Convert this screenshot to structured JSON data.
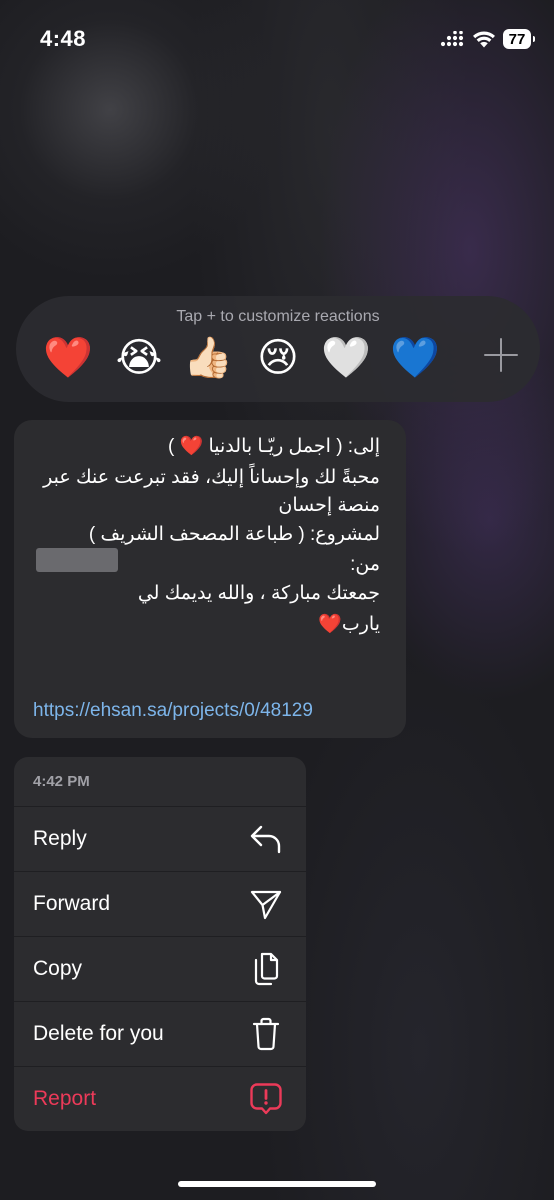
{
  "status_bar": {
    "time": "4:48",
    "battery": "77"
  },
  "reactions": {
    "hint": "Tap + to customize reactions",
    "emojis": [
      {
        "icon": "red-heart-icon",
        "char": "❤️"
      },
      {
        "icon": "loudly-crying-face-icon",
        "char": "😭"
      },
      {
        "icon": "thumbs-up-icon",
        "char": "👍🏻"
      },
      {
        "icon": "crying-face-icon",
        "char": "😢"
      },
      {
        "icon": "white-heart-icon",
        "char": "🤍"
      },
      {
        "icon": "blue-heart-icon",
        "char": "💙"
      }
    ],
    "more_icon": "plus-icon"
  },
  "message": {
    "lines": [
      "إلى: ( اجمل ريّـا بالدنيا ❤️ )",
      "محبةً لك وإحساناً إليك، فقد تبرعت عنك عبر",
      "منصة إحسان",
      "لمشروع: ( طباعة المصحف الشريف )",
      "من:",
      "جمعتك مباركة ، والله يديمك لي",
      "يارب❤️"
    ],
    "link": "https://ehsan.sa/projects/0/48129"
  },
  "context_menu": {
    "timestamp": "4:42 PM",
    "items": [
      {
        "label": "Reply",
        "icon": "reply-arrow-icon"
      },
      {
        "label": "Forward",
        "icon": "paper-plane-icon"
      },
      {
        "label": "Copy",
        "icon": "copy-icon"
      },
      {
        "label": "Delete for you",
        "icon": "trash-icon"
      },
      {
        "label": "Report",
        "icon": "report-alert-icon",
        "color": "#ec3a59"
      }
    ]
  }
}
